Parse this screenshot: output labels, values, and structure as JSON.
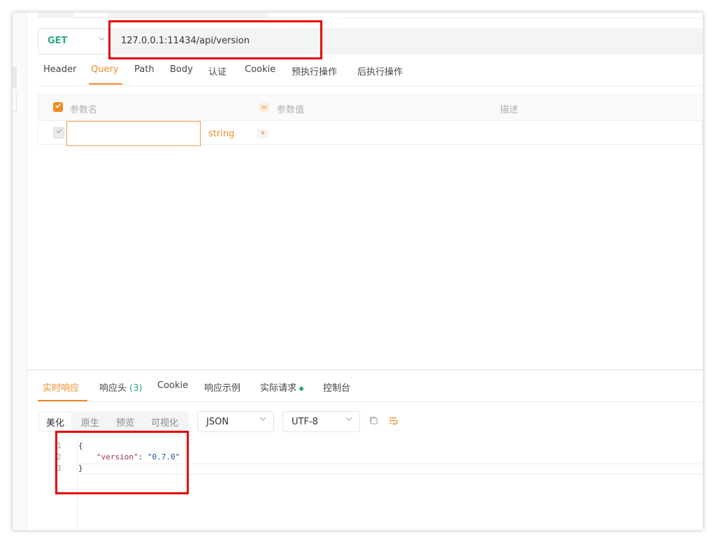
{
  "request": {
    "method": "GET",
    "url": "127.0.0.1:11434/api/version",
    "tabs": [
      "Header",
      "Query",
      "Path",
      "Body",
      "认证",
      "Cookie",
      "预执行操作",
      "后执行操作"
    ],
    "active_tab": "Query"
  },
  "params": {
    "headers": {
      "name": "参数名",
      "value": "参数值",
      "desc": "描述"
    },
    "row": {
      "type": "string",
      "required_mark": "*"
    }
  },
  "response": {
    "tabs": {
      "realtime": "实时响应",
      "headers": "响应头",
      "headers_count": "(3)",
      "cookie": "Cookie",
      "example": "响应示例",
      "actual": "实际请求",
      "console": "控制台"
    },
    "formats": [
      "美化",
      "原生",
      "预览",
      "可视化"
    ],
    "active_format": "美化",
    "type": "JSON",
    "encoding": "UTF-8",
    "code": {
      "line_numbers": [
        "1",
        "2",
        "3"
      ],
      "open_brace": "{",
      "key": "\"version\"",
      "colon": ": ",
      "value": "\"0.7.0\"",
      "close_brace": "}"
    }
  },
  "colors": {
    "accent": "#f08a24",
    "method_green": "#2ead7b",
    "annotation_red": "#e60000"
  },
  "icons": [
    "chevron-down-icon",
    "check-icon",
    "copy-icon",
    "wrap-icon"
  ]
}
